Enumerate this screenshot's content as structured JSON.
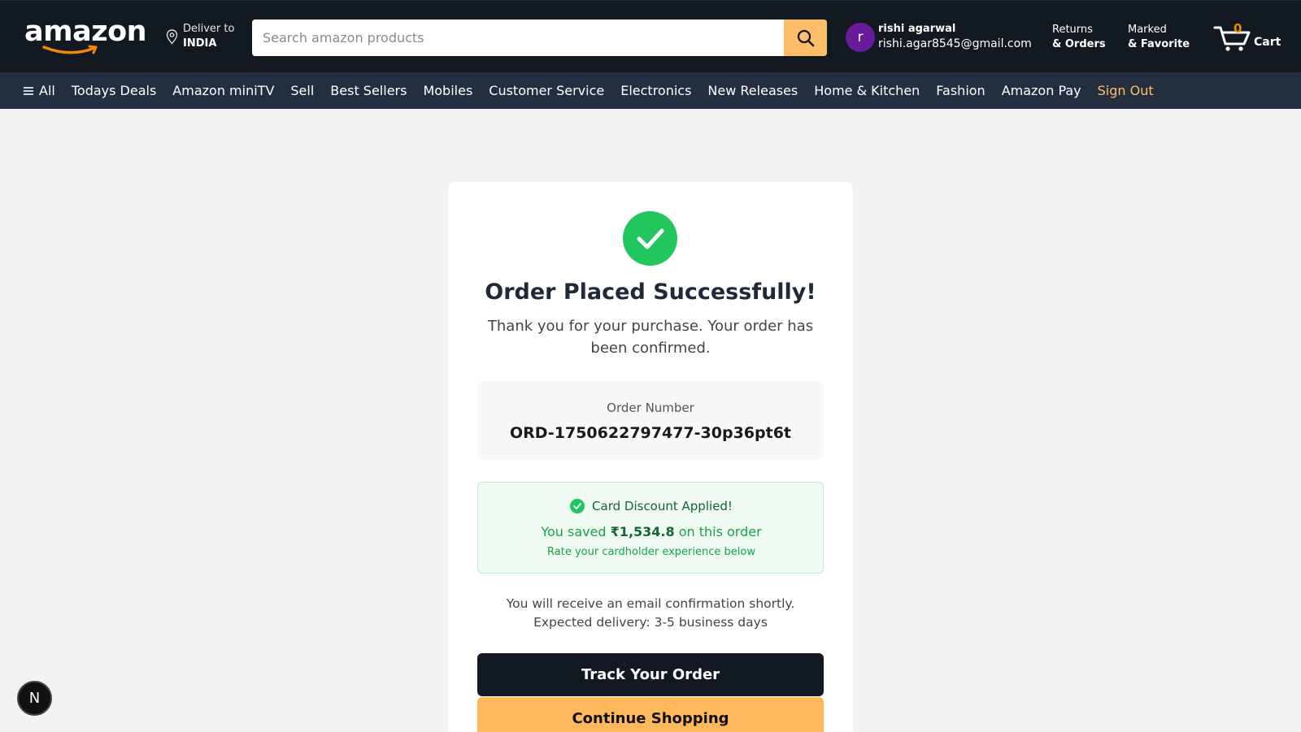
{
  "header": {
    "logo_text": "amazon",
    "deliver_label": "Deliver to",
    "deliver_country": "INDIA",
    "search_placeholder": "Search amazon products",
    "search_value": "",
    "user": {
      "avatar_letter": "r",
      "name": "rishi agarwal",
      "email": "rishi.agar8545@gmail.com"
    },
    "returns_line1": "Returns",
    "returns_line2": "& Orders",
    "marked_line1": "Marked",
    "marked_line2": "& Favorite",
    "cart_count": "0",
    "cart_label": "Cart"
  },
  "nav": {
    "all_label": "All",
    "items": [
      "Todays Deals",
      "Amazon miniTV",
      "Sell",
      "Best Sellers",
      "Mobiles",
      "Customer Service",
      "Electronics",
      "New Releases",
      "Home & Kitchen",
      "Fashion",
      "Amazon Pay"
    ],
    "signout_label": "Sign Out"
  },
  "confirmation": {
    "title": "Order Placed Successfully!",
    "subtitle": "Thank you for your purchase. Your order has been confirmed.",
    "order_number_label": "Order Number",
    "order_number": "ORD-1750622797477-30p36pt6t",
    "discount": {
      "heading": "Card Discount Applied!",
      "saved_prefix": "You saved ",
      "saved_amount": "₹1,534.8",
      "saved_suffix": " on this order",
      "rate_note": "Rate your cardholder experience below"
    },
    "email_note": "You will receive an email confirmation shortly.",
    "delivery_note": "Expected delivery: 3-5 business days",
    "track_button": "Track Your Order",
    "continue_button": "Continue Shopping"
  },
  "floating_badge": "N",
  "colors": {
    "header_bg": "#131921",
    "nav_bg": "#232f3e",
    "accent": "#febd69",
    "success": "#22c55e"
  }
}
